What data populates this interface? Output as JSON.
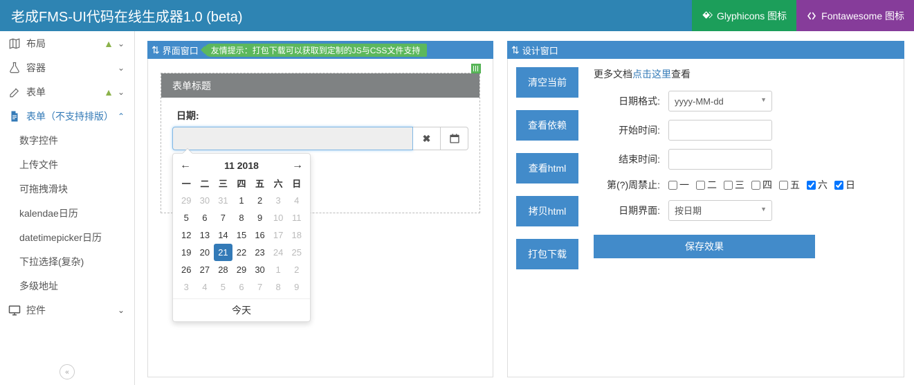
{
  "header": {
    "title": "老成FMS-UI代码在线生成器1.0 (beta)",
    "glyph_btn": "Glyphicons 图标",
    "fa_btn": "Fontawesome 图标"
  },
  "sidebar": {
    "items": [
      {
        "label": "布局",
        "icon": "map-icon",
        "warn": true,
        "chev": "down"
      },
      {
        "label": "容器",
        "icon": "flask-icon",
        "warn": false,
        "chev": "down"
      },
      {
        "label": "表单",
        "icon": "edit-icon",
        "warn": true,
        "chev": "down"
      },
      {
        "label": "表单（不支持排版）",
        "icon": "file-icon",
        "warn": false,
        "chev": "up",
        "active": true
      }
    ],
    "children": [
      "数字控件",
      "上传文件",
      "可拖拽滑块",
      "kalendae日历",
      "datetimepicker日历",
      "下拉选择(复杂)",
      "多级地址"
    ],
    "controls_label": "控件"
  },
  "ui_panel": {
    "title": "界面窗口",
    "tip": "友情提示：打包下载可以获取到定制的JS与CSS文件支持",
    "form_title": "表单标题",
    "date_label": "日期:"
  },
  "calendar": {
    "month_title": "11 2018",
    "dows": [
      "一",
      "二",
      "三",
      "四",
      "五",
      "六",
      "日"
    ],
    "weeks": [
      [
        {
          "n": "29",
          "m": true
        },
        {
          "n": "30",
          "m": true
        },
        {
          "n": "31",
          "m": true
        },
        {
          "n": "1"
        },
        {
          "n": "2"
        },
        {
          "n": "3",
          "m": true
        },
        {
          "n": "4",
          "m": true
        }
      ],
      [
        {
          "n": "5"
        },
        {
          "n": "6"
        },
        {
          "n": "7"
        },
        {
          "n": "8"
        },
        {
          "n": "9"
        },
        {
          "n": "10",
          "m": true
        },
        {
          "n": "11",
          "m": true
        }
      ],
      [
        {
          "n": "12"
        },
        {
          "n": "13"
        },
        {
          "n": "14"
        },
        {
          "n": "15"
        },
        {
          "n": "16"
        },
        {
          "n": "17",
          "m": true
        },
        {
          "n": "18",
          "m": true
        }
      ],
      [
        {
          "n": "19"
        },
        {
          "n": "20"
        },
        {
          "n": "21",
          "s": true
        },
        {
          "n": "22"
        },
        {
          "n": "23"
        },
        {
          "n": "24",
          "m": true
        },
        {
          "n": "25",
          "m": true
        }
      ],
      [
        {
          "n": "26"
        },
        {
          "n": "27"
        },
        {
          "n": "28"
        },
        {
          "n": "29"
        },
        {
          "n": "30"
        },
        {
          "n": "1",
          "m": true
        },
        {
          "n": "2",
          "m": true
        }
      ],
      [
        {
          "n": "3",
          "m": true
        },
        {
          "n": "4",
          "m": true
        },
        {
          "n": "5",
          "m": true
        },
        {
          "n": "6",
          "m": true
        },
        {
          "n": "7",
          "m": true
        },
        {
          "n": "8",
          "m": true
        },
        {
          "n": "9",
          "m": true
        }
      ]
    ],
    "today": "今天"
  },
  "design": {
    "title": "设计窗口",
    "actions": [
      "清空当前",
      "查看依赖",
      "查看html",
      "拷贝html",
      "打包下载"
    ],
    "docs_prefix": "更多文档",
    "docs_link": "点击这里",
    "docs_suffix": "查看",
    "rows": {
      "format_label": "日期格式:",
      "format_value": "yyyy-MM-dd",
      "start_label": "开始时间:",
      "end_label": "结束时间:",
      "disabled_label": "第(?)周禁止:",
      "week_opts": [
        "一",
        "二",
        "三",
        "四",
        "五",
        "六",
        "日"
      ],
      "week_checked": [
        false,
        false,
        false,
        false,
        false,
        true,
        true
      ],
      "ui_label": "日期界面:",
      "ui_value": "按日期"
    },
    "save": "保存效果"
  }
}
